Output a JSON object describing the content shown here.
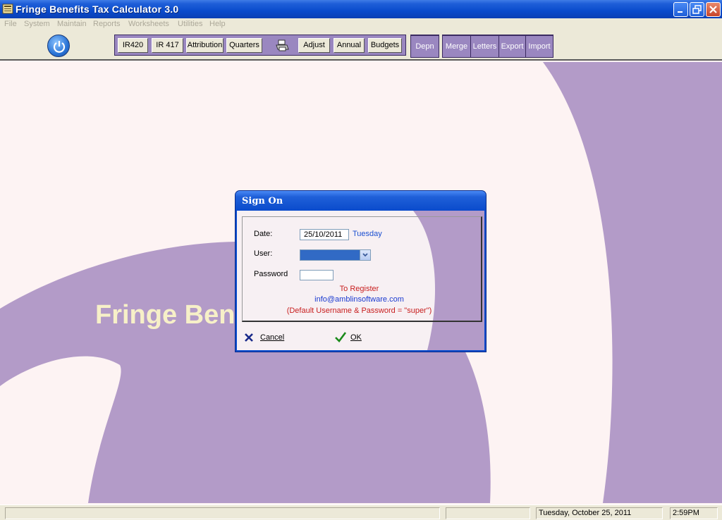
{
  "window": {
    "title": "Fringe Benefits Tax Calculator 3.0",
    "minimize_icon": "minimize-icon",
    "restore_icon": "restore-icon",
    "close_icon": "close-icon"
  },
  "menu": {
    "items": [
      "File",
      "System",
      "Maintain",
      "Reports",
      "Worksheets",
      "Utilities",
      "Help"
    ]
  },
  "toolbar": {
    "power_icon": "power-icon",
    "group1": [
      "IR420",
      "IR 417",
      "Attribution",
      "Quarters",
      "Adjust",
      "Annual",
      "Budgets"
    ],
    "printer_icon": "printer-icon",
    "depn": "Depn",
    "group2": [
      "Merge",
      "Letters",
      "Export",
      "Import"
    ]
  },
  "background": {
    "brand_text": "Fringe Ben"
  },
  "dialog": {
    "title": "Sign On",
    "date_label": "Date:",
    "date_value": "25/10/2011",
    "day_name": "Tuesday",
    "user_label": "User:",
    "user_value": "",
    "password_label": "Password",
    "register_text": "To Register",
    "email": "info@amblinsoftware.com",
    "default_note": "(Default Username & Password = \"super\")",
    "cancel_label": "Cancel",
    "ok_label": "OK"
  },
  "statusbar": {
    "date": "Tuesday, October 25, 2011",
    "time": "2:59PM"
  },
  "colors": {
    "titlebar": "#0a4bcc",
    "purple": "#b39bc8",
    "background": "#fdf3f3",
    "toolbar_group": "#9a87c0"
  }
}
